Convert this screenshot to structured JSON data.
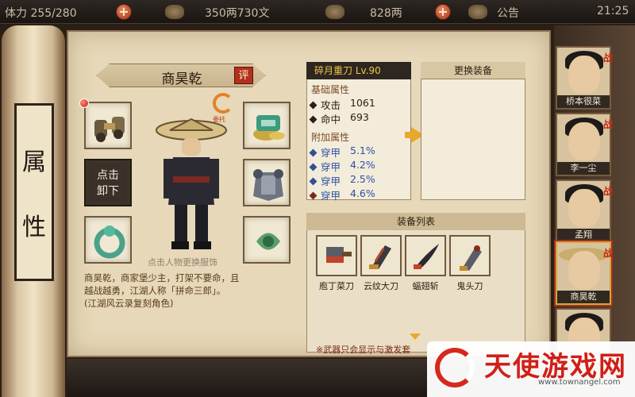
{
  "topbar": {
    "stamina": "体力 255/280",
    "silver": "350两730文",
    "gold": "828两",
    "notice": "公告",
    "clock": "21:25"
  },
  "side_tab": {
    "char1": "属",
    "char2": "性"
  },
  "character": {
    "name": "商昊乾",
    "rate_badge": "评",
    "entrust": "委托",
    "unequip_line1": "点击",
    "unequip_line2": "卸下",
    "hint": "点击人物更换服饰",
    "desc_line1": "商昊乾，商家堡少主，打架不要命，且",
    "desc_line2": "越战越勇，江湖人称「拼命三郎」。",
    "desc_line3": "(江湖风云录复刻角色)"
  },
  "weapon": {
    "title": "碎月重刀 Lv.90",
    "base_label": "基础属性",
    "base": [
      {
        "name": "攻击",
        "value": "1061"
      },
      {
        "name": "命中",
        "value": "693"
      }
    ],
    "extra_label": "附加属性",
    "extra": [
      {
        "name": "穿甲",
        "value": "5.1%"
      },
      {
        "name": "穿甲",
        "value": "4.2%"
      },
      {
        "name": "穿甲",
        "value": "2.5%"
      },
      {
        "name": "穿甲",
        "value": "4.6%"
      }
    ]
  },
  "swap": {
    "title": "更换装备"
  },
  "equip_list": {
    "title": "装备列表",
    "items": [
      "庖丁菜刀",
      "云纹大刀",
      "蝠翅斩",
      "鬼头刀"
    ],
    "note": "※武器只会显示与激发套"
  },
  "heroes": [
    {
      "name": "桥本很菜",
      "badge": "战"
    },
    {
      "name": "李一尘",
      "badge": "战"
    },
    {
      "name": "孟翔",
      "badge": "战"
    },
    {
      "name": "商昊乾",
      "badge": "战"
    }
  ],
  "watermark": {
    "title": "天使游戏网",
    "url": "www.townangel.com"
  },
  "colors": {
    "accent_red": "#b2301c",
    "gold_text": "#f0c64a",
    "extra_blue": "#2c4fa6"
  }
}
